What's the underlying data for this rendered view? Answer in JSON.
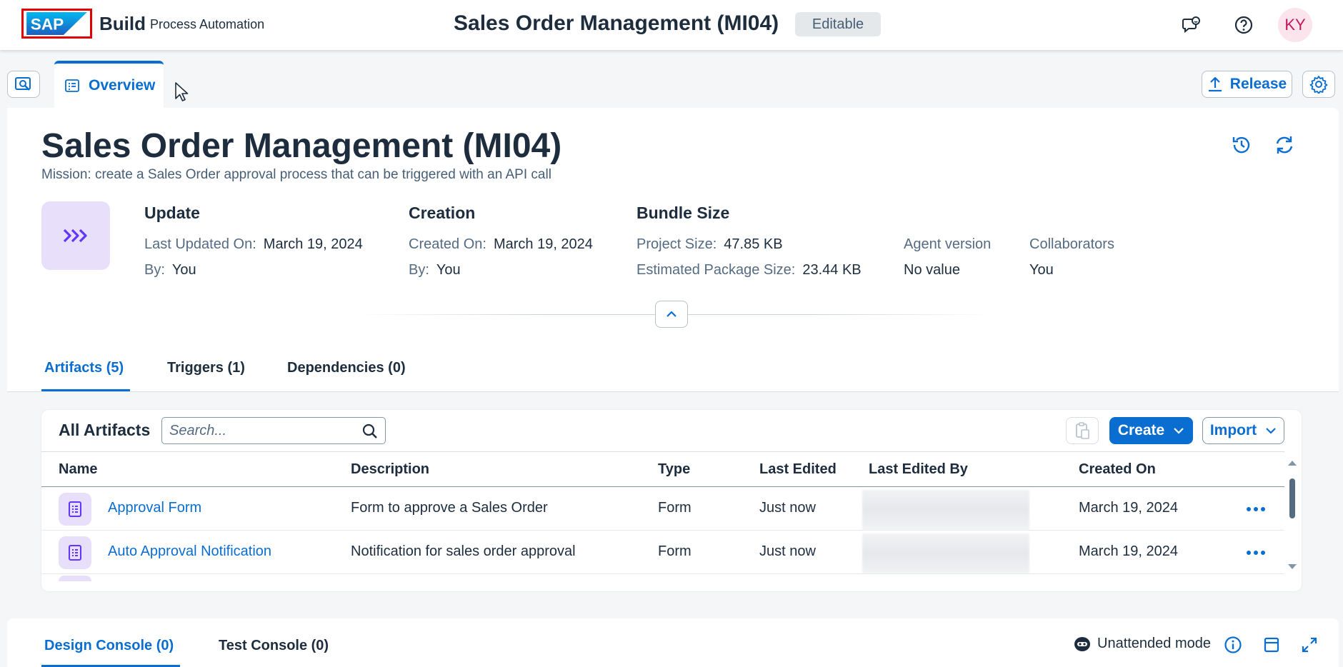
{
  "shell": {
    "logo_text": "SAP",
    "brand": "Build",
    "product": "Process Automation",
    "title": "Sales Order Management (MI04)",
    "badge": "Editable",
    "avatar_initials": "KY",
    "icons": [
      "feedback-icon",
      "help-icon"
    ]
  },
  "toolbar": {
    "search_icon": "search-icon",
    "overview_tab": "Overview",
    "release_label": "Release",
    "settings_icon": "gear-icon"
  },
  "header": {
    "title": "Sales Order Management (MI04)",
    "subtitle": "Mission: create a Sales Order approval process that can be triggered with an API call",
    "icons": [
      "history-icon",
      "refresh-icon"
    ],
    "tile_icon": "process-chevrons-icon"
  },
  "meta": {
    "update": {
      "heading": "Update",
      "last_updated_label": "Last Updated On:",
      "last_updated_value": "March 19, 2024",
      "by_label": "By:",
      "by_value": "You"
    },
    "creation": {
      "heading": "Creation",
      "created_label": "Created On:",
      "created_value": "March 19, 2024",
      "by_label": "By:",
      "by_value": "You"
    },
    "bundle": {
      "heading": "Bundle Size",
      "project_label": "Project Size:",
      "project_value": "47.85 KB",
      "package_label": "Estimated Package Size:",
      "package_value": "23.44 KB"
    },
    "agent": {
      "label": "Agent version",
      "value": "No value"
    },
    "collaborators": {
      "label": "Collaborators",
      "value": "You"
    }
  },
  "object_tabs": [
    {
      "label": "Artifacts (5)"
    },
    {
      "label": "Triggers (1)"
    },
    {
      "label": "Dependencies (0)"
    }
  ],
  "artifacts": {
    "title": "All Artifacts",
    "search_placeholder": "Search...",
    "create_label": "Create",
    "import_label": "Import",
    "columns": [
      "Name",
      "Description",
      "Type",
      "Last Edited",
      "Last Edited By",
      "Created On"
    ],
    "rows": [
      {
        "name": "Approval Form",
        "description": "Form to approve a Sales Order",
        "type": "Form",
        "last_edited": "Just now",
        "created_on": "March 19, 2024"
      },
      {
        "name": "Auto Approval Notification",
        "description": "Notification for sales order approval",
        "type": "Form",
        "last_edited": "Just now",
        "created_on": "March 19, 2024"
      }
    ]
  },
  "console": {
    "tabs": [
      {
        "label": "Design Console (0)"
      },
      {
        "label": "Test Console (0)"
      }
    ],
    "mode_label": "Unattended mode"
  },
  "colors": {
    "accent": "#0a6ed1",
    "text": "#1d2d3e",
    "tile_bg": "#e8e0fb",
    "tile_icon": "#5d36ff",
    "logo_frame": "#e00000",
    "avatar_bg": "#fce4ec"
  }
}
